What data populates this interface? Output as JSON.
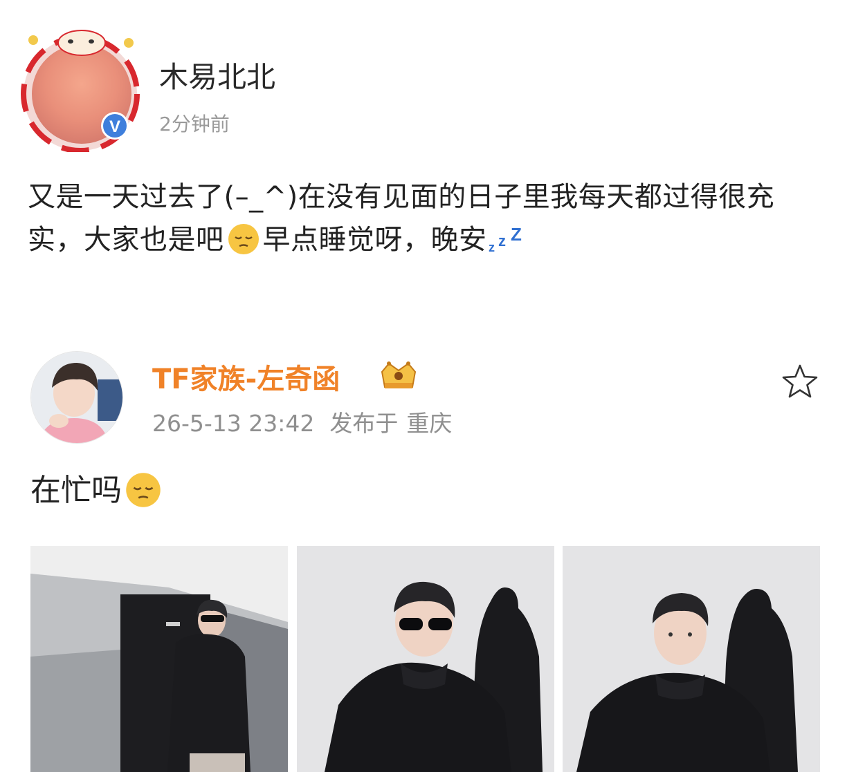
{
  "post1": {
    "author": "木易北北",
    "time": "2分钟前",
    "text_part1": "又是一天过去了(–_^)在没有见面的日子里我每天都过得很充实，大家也是吧",
    "text_part2": "早点睡觉呀，晚安",
    "emoji": "pensive-face-emoji",
    "zzz_icon": "zzz-sleep-icon",
    "verified_color": "#3f7fdc"
  },
  "post2": {
    "author": "TF家族-左奇函",
    "author_color": "#f08228",
    "badge": "crown-badge-icon",
    "date": "26-5-13 23:42",
    "location_prefix": "发布于",
    "location": "重庆",
    "text": "在忙吗",
    "emoji": "pensive-face-emoji",
    "favorite_icon": "star-outline-icon",
    "photos": [
      {
        "name": "photo-1",
        "scene": "hallway with mirrors, person in sunglasses and black hoodie"
      },
      {
        "name": "photo-2",
        "scene": "person in sunglasses beside black mannequin"
      },
      {
        "name": "photo-3",
        "scene": "person in black hoodie beside black mannequin"
      }
    ]
  }
}
